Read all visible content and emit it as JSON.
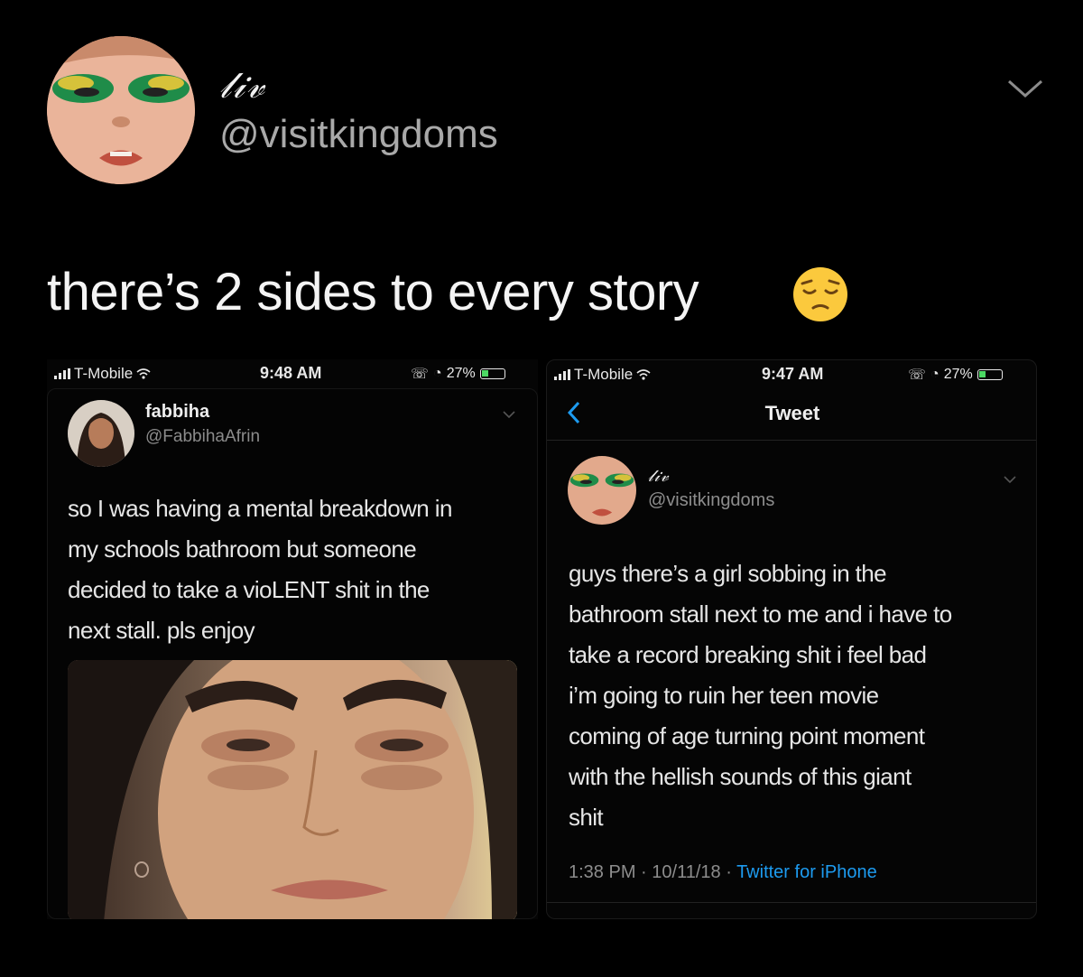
{
  "main_tweet": {
    "display_name": "𝓁𝒾𝓋",
    "handle": "@visitkingdoms",
    "text": "there’s 2 sides to every story",
    "emoji": "pensive-face-emoji"
  },
  "left_screenshot": {
    "status_bar": {
      "carrier": "T-Mobile",
      "time": "9:48 AM",
      "battery": "27%"
    },
    "tweet": {
      "display_name": "fabbiha",
      "handle": "@FabbihaAfrin",
      "text_lines": [
        "so I was having a mental breakdown in",
        "my schools bathroom but someone",
        "decided to take a vioLENT shit in the",
        "next stall. pls enjoy"
      ]
    }
  },
  "right_screenshot": {
    "status_bar": {
      "carrier": "T-Mobile",
      "time": "9:47 AM",
      "battery": "27%"
    },
    "header_title": "Tweet",
    "tweet": {
      "display_name": "𝓁𝒾𝓋",
      "handle": "@visitkingdoms",
      "text_lines": [
        "guys there’s a girl sobbing in the",
        "bathroom stall next to me and i have to",
        "take a record breaking shit i feel bad",
        "i’m going to ruin her teen movie",
        "coming of age turning point moment",
        "with the hellish sounds of this giant",
        "shit"
      ],
      "time": "1:38 PM",
      "date": "10/11/18",
      "source": "Twitter for iPhone"
    }
  },
  "colors": {
    "background": "#000000",
    "link": "#1d9bf0",
    "secondary_text": "#8d8d8d"
  }
}
